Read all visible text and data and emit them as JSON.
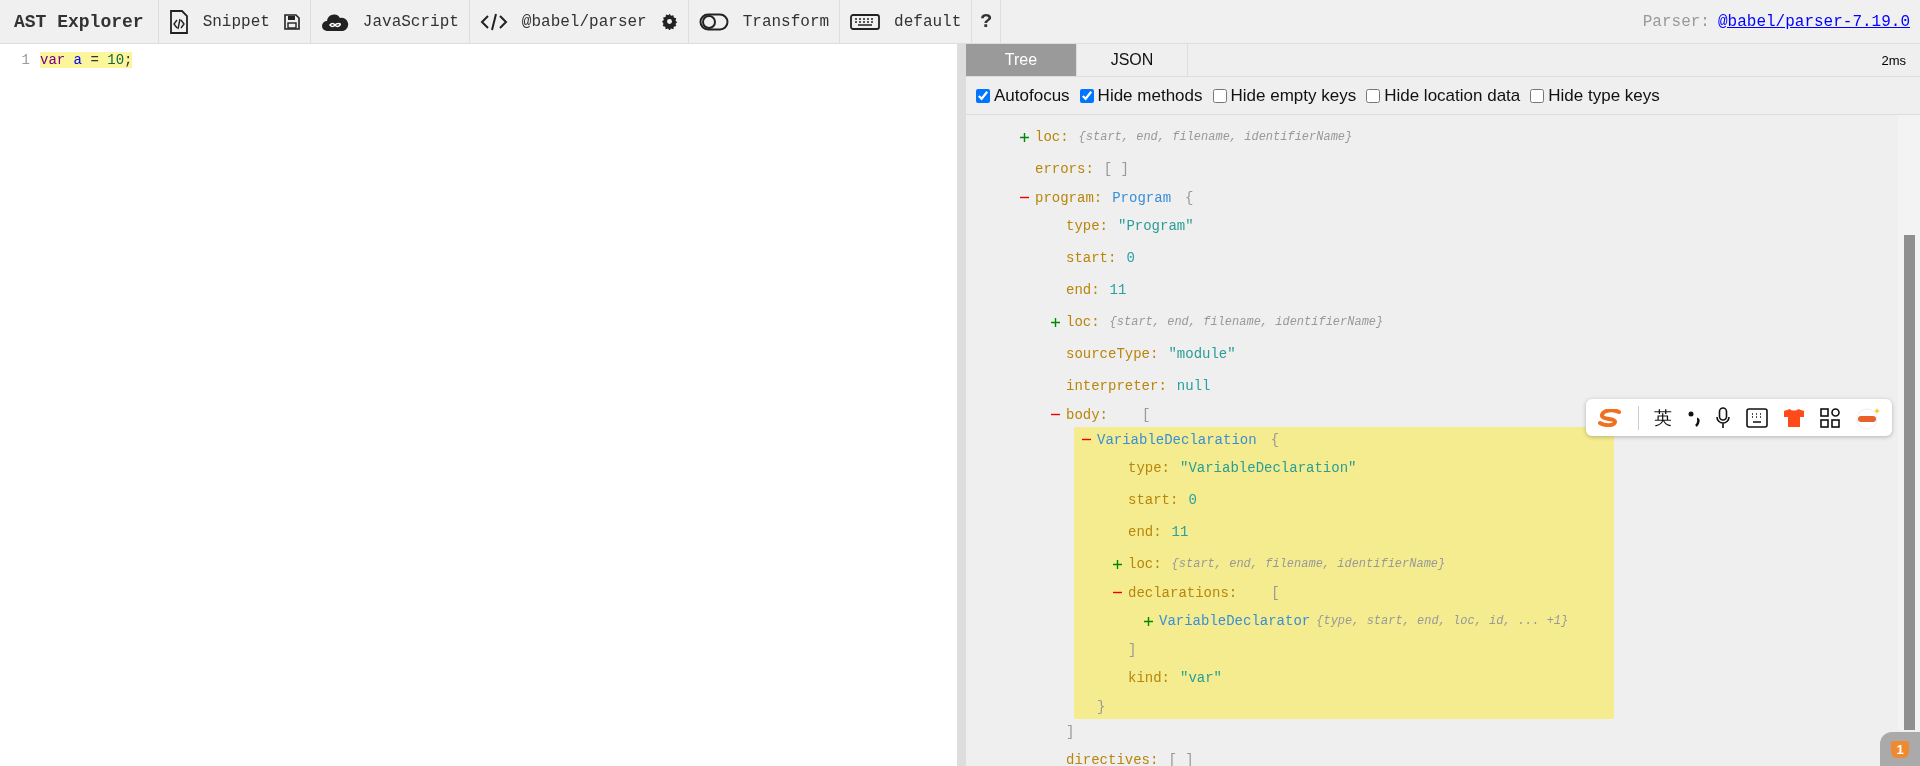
{
  "toolbar": {
    "title": "AST Explorer",
    "items": [
      {
        "kind": "snippet",
        "label": "Snippet"
      },
      {
        "kind": "language",
        "label": "JavaScript"
      },
      {
        "kind": "parser",
        "label": "@babel/parser"
      },
      {
        "kind": "transform",
        "label": "Transform"
      },
      {
        "kind": "keymap",
        "label": "default"
      },
      {
        "kind": "help",
        "label": "?"
      }
    ],
    "parser_label": "Parser:",
    "parser_link": "@babel/parser-7.19.0"
  },
  "editor": {
    "lines": [
      {
        "number": "1",
        "highlighted": true,
        "tokens": [
          {
            "kind": "keyword",
            "text": "var "
          },
          {
            "kind": "variable",
            "text": "a"
          },
          {
            "kind": "operator",
            "text": " = "
          },
          {
            "kind": "number",
            "text": "10"
          },
          {
            "kind": "punct",
            "text": ";"
          }
        ]
      }
    ]
  },
  "panel": {
    "tabs": [
      {
        "label": "Tree",
        "selected": true
      },
      {
        "label": "JSON",
        "selected": false
      }
    ],
    "time": "2ms",
    "options": [
      {
        "label": "Autofocus",
        "checked": true
      },
      {
        "label": "Hide methods",
        "checked": true
      },
      {
        "label": "Hide empty keys",
        "checked": false
      },
      {
        "label": "Hide location data",
        "checked": false
      },
      {
        "label": "Hide type keys",
        "checked": false
      }
    ],
    "tree": [
      {
        "key": "loc:",
        "kind": "collapsed",
        "expanded": false,
        "summary": "{start, end, filename, identifierName}"
      },
      {
        "key": "errors:",
        "kind": "empty",
        "value": "[ ]"
      },
      {
        "key": "program:",
        "kind": "node",
        "expanded": true,
        "type_name": "Program",
        "open": "{",
        "children": [
          {
            "key": "type:",
            "kind": "string",
            "value": "\"Program\""
          },
          {
            "key": "start:",
            "kind": "number",
            "value": "0"
          },
          {
            "key": "end:",
            "kind": "number",
            "value": "11"
          },
          {
            "key": "loc:",
            "kind": "collapsed",
            "expanded": false,
            "summary": "{start, end, filename, identifierName}"
          },
          {
            "key": "sourceType:",
            "kind": "string",
            "value": "\"module\""
          },
          {
            "key": "interpreter:",
            "kind": "number",
            "value": "null"
          },
          {
            "key": "body:",
            "kind": "list",
            "expanded": true,
            "open": "[",
            "close": "]",
            "children": [
              {
                "kind": "node",
                "expanded": true,
                "highlighted": true,
                "type_name": "VariableDeclaration",
                "open": "{",
                "close": "}",
                "children": [
                  {
                    "key": "type:",
                    "kind": "string",
                    "value": "\"VariableDeclaration\""
                  },
                  {
                    "key": "start:",
                    "kind": "number",
                    "value": "0"
                  },
                  {
                    "key": "end:",
                    "kind": "number",
                    "value": "11"
                  },
                  {
                    "key": "loc:",
                    "kind": "collapsed",
                    "expanded": false,
                    "summary": "{start, end, filename, identifierName}"
                  },
                  {
                    "key": "declarations:",
                    "kind": "list",
                    "expanded": true,
                    "open": "[",
                    "close": "]",
                    "children": [
                      {
                        "kind": "collapsed",
                        "expanded": false,
                        "type_name": "VariableDeclarator",
                        "summary": "{type, start, end, loc, id, ... +1}"
                      }
                    ]
                  },
                  {
                    "key": "kind:",
                    "kind": "string",
                    "value": "\"var\""
                  }
                ]
              }
            ]
          },
          {
            "key": "directives:",
            "kind": "empty",
            "value": "[ ]"
          }
        ]
      }
    ]
  },
  "ime_toolbar": {
    "mode": "英"
  },
  "notification_badge": "1"
}
